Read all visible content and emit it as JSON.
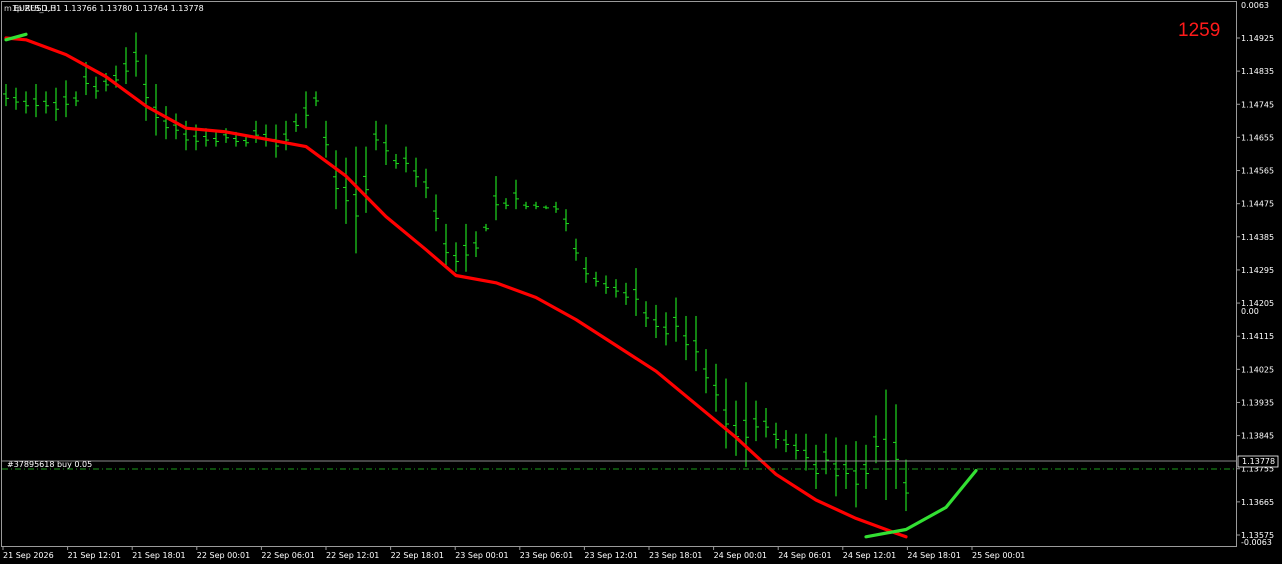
{
  "header": {
    "symbol_line": "EURUSD,H1 1.13766 1.13780 1.13764 1.13778",
    "overlay_line": "m1p ZFS_1.3"
  },
  "counter_label": "1259",
  "order_line_label": "#37895618 buy 0.05",
  "colors": {
    "background": "#000000",
    "bars": "#1ed81e",
    "ma_down": "#ff0000",
    "ma_up": "#33e033",
    "order_line": "#8a8a8a",
    "ask_line": "#1c9c1c",
    "counter": "#ff1a1a",
    "axis_text": "#ffffff"
  },
  "chart_data": {
    "type": "ohlc",
    "price_axis": {
      "ticks": [
        "1.14925",
        "1.14835",
        "1.14745",
        "1.14655",
        "1.14565",
        "1.14475",
        "1.14385",
        "1.14295",
        "1.14205",
        "1.14115",
        "1.14025",
        "1.13935",
        "1.13845",
        "1.13755",
        "1.13665",
        "1.13575"
      ],
      "current_price": "1.13778",
      "ylim": [
        1.1357,
        1.1502
      ]
    },
    "indicator_axis": {
      "labels": [
        "0.0063",
        "0.00",
        "-0.0063"
      ]
    },
    "time_axis": {
      "labels": [
        "21 Sep 2026",
        "21 Sep 12:01",
        "21 Sep 18:01",
        "22 Sep 00:01",
        "22 Sep 06:01",
        "22 Sep 12:01",
        "22 Sep 18:01",
        "23 Sep 00:01",
        "23 Sep 06:01",
        "23 Sep 12:01",
        "23 Sep 18:01",
        "24 Sep 00:01",
        "24 Sep 06:01",
        "24 Sep 12:01",
        "24 Sep 18:01",
        "25 Sep 00:01"
      ]
    },
    "bar_count": 91,
    "bars_hl": [
      [
        1.148,
        1.1474
      ],
      [
        1.1479,
        1.1473
      ],
      [
        1.1478,
        1.1472
      ],
      [
        1.148,
        1.1471
      ],
      [
        1.1478,
        1.1472
      ],
      [
        1.1479,
        1.147
      ],
      [
        1.1481,
        1.1471
      ],
      [
        1.1478,
        1.1474
      ],
      [
        1.1486,
        1.1477
      ],
      [
        1.1482,
        1.1476
      ],
      [
        1.1483,
        1.1478
      ],
      [
        1.1485,
        1.1479
      ],
      [
        1.149,
        1.148
      ],
      [
        1.1494,
        1.1482
      ],
      [
        1.1488,
        1.147
      ],
      [
        1.148,
        1.1466
      ],
      [
        1.1474,
        1.1465
      ],
      [
        1.1472,
        1.1465
      ],
      [
        1.147,
        1.1462
      ],
      [
        1.1469,
        1.1462
      ],
      [
        1.1468,
        1.1463
      ],
      [
        1.1467,
        1.1463
      ],
      [
        1.1468,
        1.1464
      ],
      [
        1.1467,
        1.1463
      ],
      [
        1.1466,
        1.1463
      ],
      [
        1.147,
        1.1464
      ],
      [
        1.1469,
        1.1463
      ],
      [
        1.1469,
        1.146
      ],
      [
        1.147,
        1.1462
      ],
      [
        1.1472,
        1.1467
      ],
      [
        1.1478,
        1.1468
      ],
      [
        1.1478,
        1.1474
      ],
      [
        1.147,
        1.146
      ],
      [
        1.1462,
        1.1446
      ],
      [
        1.146,
        1.1442
      ],
      [
        1.1463,
        1.1434
      ],
      [
        1.1463,
        1.1445
      ],
      [
        1.147,
        1.1462
      ],
      [
        1.1469,
        1.1458
      ],
      [
        1.1461,
        1.1457
      ],
      [
        1.1463,
        1.1456
      ],
      [
        1.146,
        1.1452
      ],
      [
        1.1457,
        1.1449
      ],
      [
        1.145,
        1.144
      ],
      [
        1.1442,
        1.143
      ],
      [
        1.1437,
        1.1429
      ],
      [
        1.1442,
        1.1429
      ],
      [
        1.144,
        1.1433
      ],
      [
        1.1442,
        1.144
      ],
      [
        1.1455,
        1.1443
      ],
      [
        1.1449,
        1.1446
      ],
      [
        1.1454,
        1.1446
      ],
      [
        1.1448,
        1.1446
      ],
      [
        1.1448,
        1.1446
      ],
      [
        1.1447,
        1.1446
      ],
      [
        1.1448,
        1.1445
      ],
      [
        1.1446,
        1.144
      ],
      [
        1.1438,
        1.1432
      ],
      [
        1.1433,
        1.1426
      ],
      [
        1.1429,
        1.1425
      ],
      [
        1.1428,
        1.1423
      ],
      [
        1.1427,
        1.1422
      ],
      [
        1.1426,
        1.142
      ],
      [
        1.143,
        1.1417
      ],
      [
        1.1421,
        1.1414
      ],
      [
        1.142,
        1.1411
      ],
      [
        1.1418,
        1.1409
      ],
      [
        1.1422,
        1.141
      ],
      [
        1.1417,
        1.1405
      ],
      [
        1.1417,
        1.1402
      ],
      [
        1.1408,
        1.1396
      ],
      [
        1.1404,
        1.1391
      ],
      [
        1.14,
        1.1381
      ],
      [
        1.1394,
        1.1379
      ],
      [
        1.1399,
        1.1376
      ],
      [
        1.1394,
        1.1383
      ],
      [
        1.1392,
        1.1384
      ],
      [
        1.1388,
        1.1381
      ],
      [
        1.1386,
        1.138
      ],
      [
        1.1385,
        1.1378
      ],
      [
        1.1385,
        1.1375
      ],
      [
        1.1382,
        1.137
      ],
      [
        1.1385,
        1.1374
      ],
      [
        1.1384,
        1.1368
      ],
      [
        1.1382,
        1.137
      ],
      [
        1.1383,
        1.1365
      ],
      [
        1.1382,
        1.137
      ],
      [
        1.139,
        1.1377
      ],
      [
        1.1397,
        1.1367
      ],
      [
        1.1393,
        1.137
      ],
      [
        1.1378,
        1.1364
      ]
    ],
    "ma_points": [
      [
        0,
        1.14925
      ],
      [
        2,
        1.1492
      ],
      [
        6,
        1.1488
      ],
      [
        10,
        1.1482
      ],
      [
        14,
        1.1474
      ],
      [
        18,
        1.1468
      ],
      [
        22,
        1.1467
      ],
      [
        26,
        1.1465
      ],
      [
        30,
        1.1463
      ],
      [
        34,
        1.1455
      ],
      [
        38,
        1.1444
      ],
      [
        42,
        1.1435
      ],
      [
        45,
        1.1428
      ],
      [
        49,
        1.1426
      ],
      [
        53,
        1.1422
      ],
      [
        57,
        1.1416
      ],
      [
        61,
        1.1409
      ],
      [
        65,
        1.1402
      ],
      [
        69,
        1.1393
      ],
      [
        73,
        1.1384
      ],
      [
        77,
        1.1374
      ],
      [
        81,
        1.1367
      ],
      [
        85,
        1.1362
      ],
      [
        89,
        1.1358
      ],
      [
        90,
        1.1357
      ]
    ],
    "ma_up_points": [
      [
        86,
        1.1357
      ],
      [
        90,
        1.1359
      ],
      [
        94,
        1.1365
      ],
      [
        97,
        1.1375
      ]
    ],
    "ma_start_points": [
      [
        0,
        1.1492
      ],
      [
        2,
        1.14935
      ]
    ]
  }
}
